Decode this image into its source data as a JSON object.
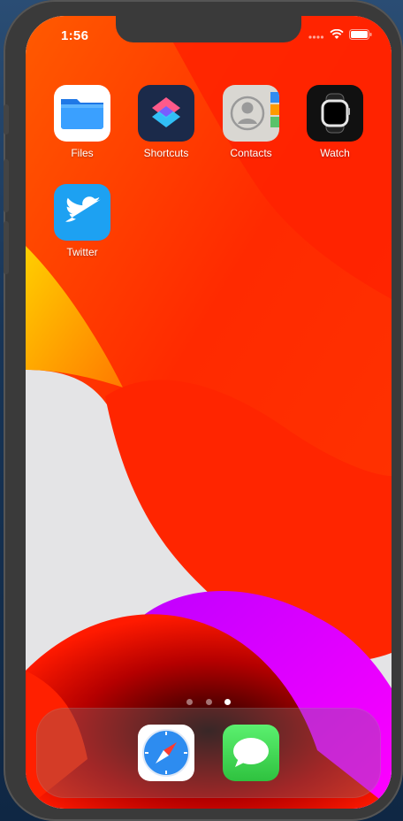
{
  "status_bar": {
    "time": "1:56",
    "signal_icon": "cellular-signal-icon",
    "wifi_icon": "wifi-icon",
    "battery_icon": "battery-icon"
  },
  "home_apps": [
    {
      "label": "Files",
      "icon": "files-folder-icon"
    },
    {
      "label": "Shortcuts",
      "icon": "shortcuts-icon"
    },
    {
      "label": "Contacts",
      "icon": "contacts-person-icon"
    },
    {
      "label": "Watch",
      "icon": "apple-watch-icon"
    },
    {
      "label": "Twitter",
      "icon": "twitter-bird-icon"
    }
  ],
  "page_indicator": {
    "pages": 3,
    "current": 3
  },
  "dock_apps": [
    {
      "icon": "safari-compass-icon"
    },
    {
      "icon": "messages-bubble-icon"
    }
  ],
  "colors": {
    "wallpaper_red": "#ff2d00",
    "wallpaper_orange": "#ff5e00",
    "wallpaper_yellow": "#ffb000",
    "wallpaper_magenta": "#ff00ff"
  }
}
